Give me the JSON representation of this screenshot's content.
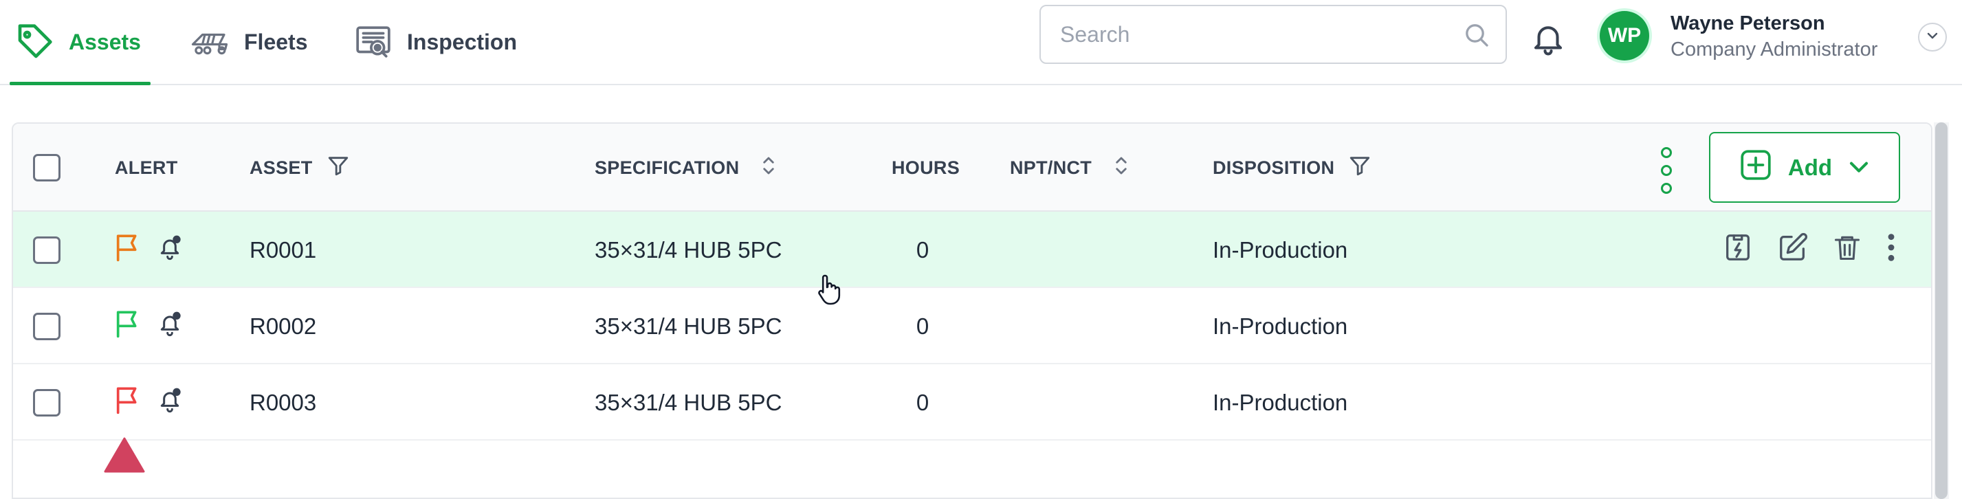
{
  "nav": {
    "tabs": [
      {
        "label": "Assets",
        "active": true,
        "icon": "tag-icon"
      },
      {
        "label": "Fleets",
        "active": false,
        "icon": "truck-icon"
      },
      {
        "label": "Inspection",
        "active": false,
        "icon": "inspection-icon"
      }
    ]
  },
  "search": {
    "placeholder": "Search",
    "value": ""
  },
  "user": {
    "initials": "WP",
    "name": "Wayne Peterson",
    "role": "Company Administrator"
  },
  "table": {
    "headers": {
      "alert": "ALERT",
      "asset": "ASSET",
      "specification": "SPECIFICATION",
      "hours": "HOURS",
      "npt_nct": "NPT/NCT",
      "disposition": "DISPOSITION"
    },
    "add_button": "Add",
    "rows": [
      {
        "asset": "R0001",
        "specification": "35×31/4 HUB 5PC",
        "hours": "0",
        "npt_nct": "",
        "disposition": "In-Production",
        "flag_color": "#ea7a1a",
        "selected_hover": true
      },
      {
        "asset": "R0002",
        "specification": "35×31/4 HUB 5PC",
        "hours": "0",
        "npt_nct": "",
        "disposition": "In-Production",
        "flag_color": "#22c55e",
        "selected_hover": false
      },
      {
        "asset": "R0003",
        "specification": "35×31/4 HUB 5PC",
        "hours": "0",
        "npt_nct": "",
        "disposition": "In-Production",
        "flag_color": "#ef4444",
        "selected_hover": false
      }
    ]
  },
  "colors": {
    "brand": "#16a34a",
    "row_highlight": "#e3fbee",
    "marker": "#d1425f"
  }
}
